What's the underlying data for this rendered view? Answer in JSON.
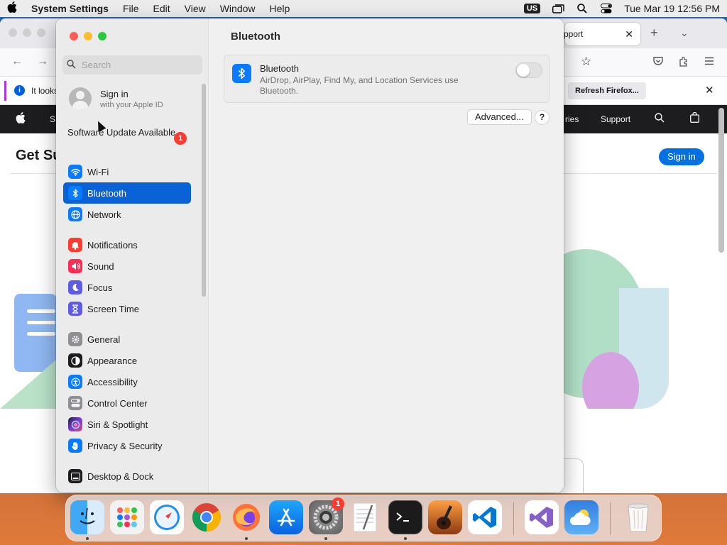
{
  "menubar": {
    "app_name": "System Settings",
    "menus": [
      "File",
      "Edit",
      "View",
      "Window",
      "Help"
    ],
    "input_source": "US",
    "datetime": "Tue Mar 19  12:56 PM"
  },
  "browser": {
    "tab_title": "pport",
    "notice_text": "It looks",
    "refresh_label": "Refresh Firefox...",
    "nav_partial_left": "S",
    "nav_partial_right": "ries",
    "nav_support": "Support",
    "heading_partial": "Get Su",
    "signin_label": "Sign in"
  },
  "sidebar": {
    "search_placeholder": "Search",
    "apple_id_title": "Sign in",
    "apple_id_subtitle": "with your Apple ID",
    "software_update": "Software Update Available",
    "software_update_badge": "1",
    "items": [
      {
        "label": "Wi-Fi",
        "icon": "wifi-icon",
        "color": "#0a7aff"
      },
      {
        "label": "Bluetooth",
        "icon": "bluetooth-icon",
        "color": "#0a7aff"
      },
      {
        "label": "Network",
        "icon": "globe-icon",
        "color": "#0a7aff"
      },
      {
        "label": "Notifications",
        "icon": "bell-icon",
        "color": "#ff3b30"
      },
      {
        "label": "Sound",
        "icon": "speaker-icon",
        "color": "#ff2d55"
      },
      {
        "label": "Focus",
        "icon": "moon-icon",
        "color": "#5e5ce6"
      },
      {
        "label": "Screen Time",
        "icon": "hourglass-icon",
        "color": "#5e5ce6"
      },
      {
        "label": "General",
        "icon": "gear-icon",
        "color": "#8e8e93"
      },
      {
        "label": "Appearance",
        "icon": "appearance-icon",
        "color": "#1c1c1e"
      },
      {
        "label": "Accessibility",
        "icon": "accessibility-icon",
        "color": "#0a7aff"
      },
      {
        "label": "Control Center",
        "icon": "control-center-icon",
        "color": "#8e8e93"
      },
      {
        "label": "Siri & Spotlight",
        "icon": "siri-icon",
        "color": "#7d3cdb"
      },
      {
        "label": "Privacy & Security",
        "icon": "hand-icon",
        "color": "#0a7aff"
      },
      {
        "label": "Desktop & Dock",
        "icon": "dock-icon",
        "color": "#1c1c1e"
      }
    ],
    "active_item": "Bluetooth"
  },
  "content": {
    "title": "Bluetooth",
    "bluetooth_name": "Bluetooth",
    "bluetooth_desc": "AirDrop, AirPlay, Find My, and Location Services use Bluetooth.",
    "bluetooth_enabled": false,
    "advanced_label": "Advanced...",
    "help_label": "?"
  },
  "dock": {
    "apps": [
      "Finder",
      "Launchpad",
      "Safari",
      "Chrome",
      "Firefox",
      "App Store",
      "System Settings",
      "TextEdit",
      "Terminal",
      "GarageBand",
      "Visual Studio Code",
      "Visual Studio",
      "Weather",
      "Trash"
    ],
    "system_settings_badge": "1"
  }
}
